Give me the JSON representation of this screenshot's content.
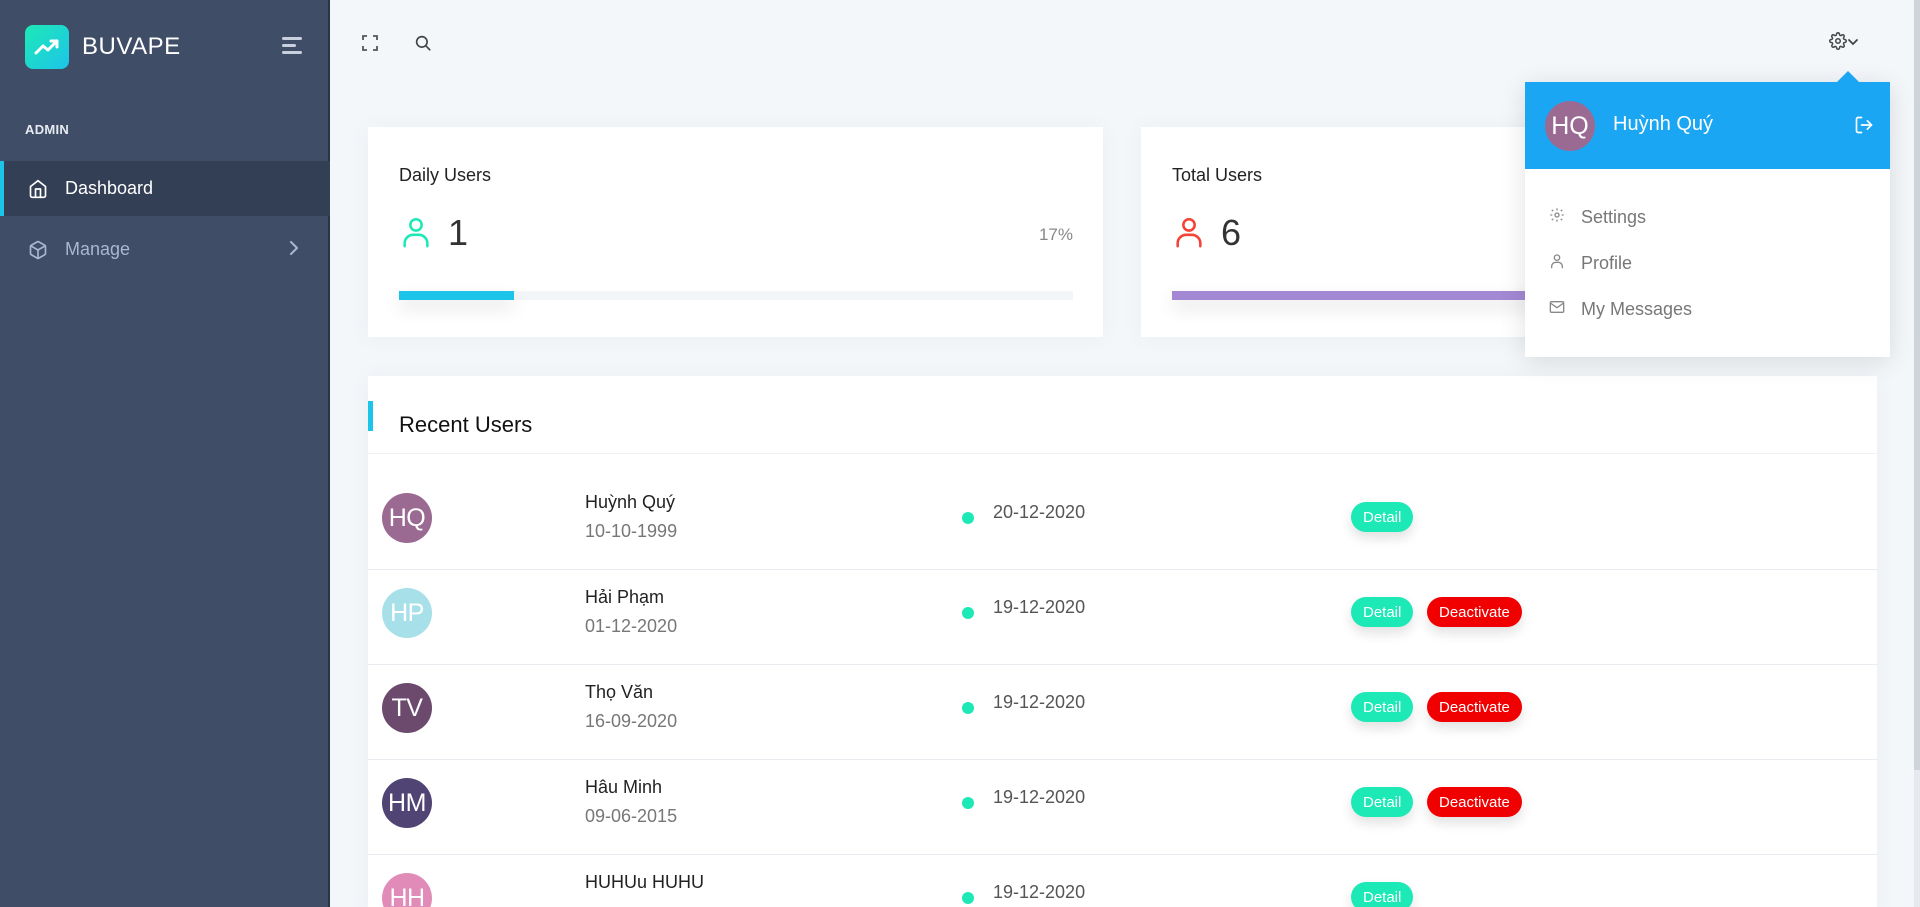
{
  "brand": {
    "name": "BUVAPE"
  },
  "sidebar": {
    "caption": "ADMIN",
    "items": [
      {
        "label": "Dashboard",
        "icon": "home-icon",
        "active": true
      },
      {
        "label": "Manage",
        "icon": "box-icon",
        "active": false
      }
    ]
  },
  "header": {
    "icons": [
      "fullscreen-icon",
      "search-icon",
      "settings-icon"
    ]
  },
  "stats": {
    "daily": {
      "title": "Daily Users",
      "value": "1",
      "percent": "17%",
      "progress": 0.17,
      "color": "#1de9b6",
      "bar_color": "#1dc4e9"
    },
    "total": {
      "title": "Total Users",
      "value": "6",
      "progress": 0.55,
      "color": "#f44236",
      "bar_color": "#a389d4"
    }
  },
  "recent": {
    "title": "Recent Users",
    "users": [
      {
        "initials": "HQ",
        "name": "Huỳnh Quý",
        "dob": "10-10-1999",
        "date": "20-12-2020",
        "avatar_color": "#9b6a93",
        "detail": "Detail",
        "deactivate": ""
      },
      {
        "initials": "HP",
        "name": "Hải Phạm",
        "dob": "01-12-2020",
        "date": "19-12-2020",
        "avatar_color": "#a8e0ea",
        "detail": "Detail",
        "deactivate": "Deactivate"
      },
      {
        "initials": "TV",
        "name": "Thọ Văn",
        "dob": "16-09-2020",
        "date": "19-12-2020",
        "avatar_color": "#6b4a6d",
        "detail": "Detail",
        "deactivate": "Deactivate"
      },
      {
        "initials": "HM",
        "name": "Hâu Minh",
        "dob": "09-06-2015",
        "date": "19-12-2020",
        "avatar_color": "#4f4473",
        "detail": "Detail",
        "deactivate": "Deactivate"
      },
      {
        "initials": "HH",
        "name": "HUHUu HUHU",
        "dob": "",
        "date": "19-12-2020",
        "avatar_color": "#e08bb8",
        "detail": "Detail",
        "deactivate": ""
      }
    ]
  },
  "dropdown": {
    "user": {
      "initials": "HQ",
      "name": "Huỳnh Quý"
    },
    "items": [
      {
        "label": "Settings",
        "icon": "settings-icon"
      },
      {
        "label": "Profile",
        "icon": "user-icon"
      },
      {
        "label": "My Messages",
        "icon": "mail-icon"
      }
    ]
  },
  "colors": {
    "sidebar": "#3f4d67",
    "accent": "#1dc4e9",
    "success": "#1de9b6",
    "danger": "#f00000",
    "dropdown_head": "#1aa6f2"
  }
}
